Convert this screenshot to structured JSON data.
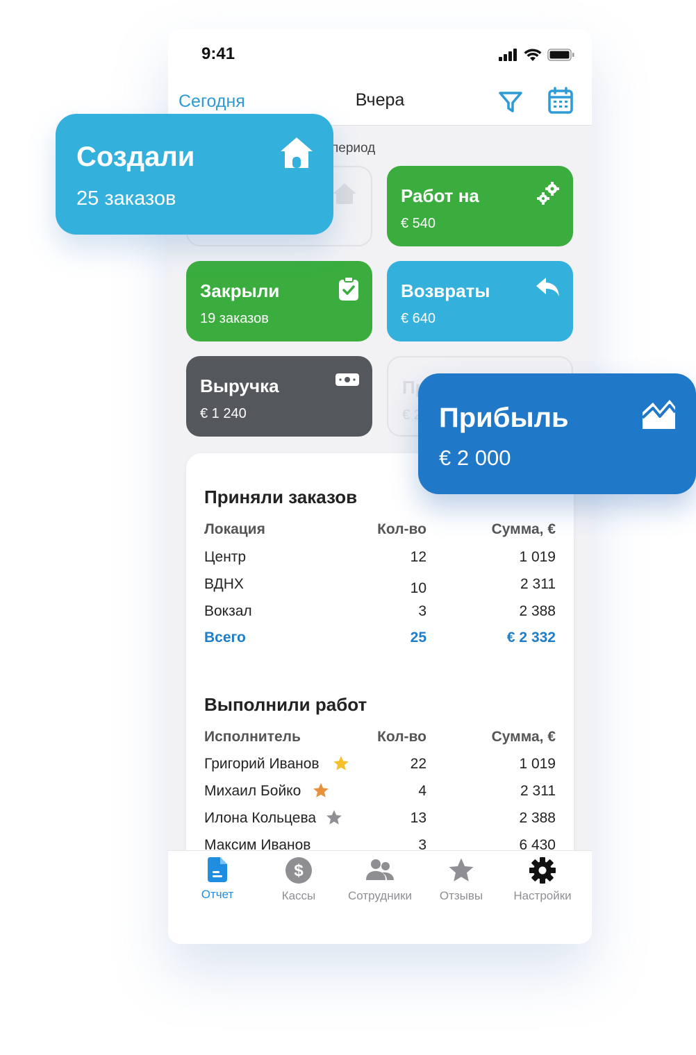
{
  "status_bar": {
    "time": "9:41"
  },
  "nav": {
    "left": "Сегодня",
    "title": "Вчера"
  },
  "period_label": "период",
  "cards": [
    {
      "title": "Работ на",
      "value": "€ 540",
      "icon": "gears-icon",
      "color": "#3aad3e"
    },
    {
      "title": "Закрыли",
      "value": "19 заказов",
      "icon": "clipboard-check-icon",
      "color": "#3aad3e"
    },
    {
      "title": "Возвраты",
      "value": "€ 640",
      "icon": "reply-icon",
      "color": "#33b0dc"
    },
    {
      "title": "Выручка",
      "value": "€ 1 240",
      "icon": "money-icon",
      "color": "#54575c"
    }
  ],
  "ghost_card": {
    "title": "Пр",
    "value": "€ 2"
  },
  "float_created": {
    "title": "Создали",
    "value": "25 заказов",
    "icon": "home-icon"
  },
  "float_profit": {
    "title": "Прибыль",
    "value": "€ 2 000",
    "icon": "chart-area-icon"
  },
  "orders": {
    "title": "Приняли заказов",
    "headers": [
      "Локация",
      "Кол-во",
      "Сумма, €"
    ],
    "rows": [
      [
        "Центр",
        "12",
        "1 019"
      ],
      [
        "ВДНХ",
        "10",
        "2 311"
      ],
      [
        "Вокзал",
        "3",
        "2 388"
      ]
    ],
    "total": [
      "Всего",
      "25",
      "€ 2 332"
    ]
  },
  "works": {
    "title": "Выполнили работ",
    "headers": [
      "Исполнитель",
      "Кол-во",
      "Сумма, €"
    ],
    "rows": [
      [
        "Григорий Иванов",
        "22",
        "1 019"
      ],
      [
        "Михаил Бойко",
        "4",
        "2 311"
      ],
      [
        "Илона Кольцева",
        "13",
        "2 388"
      ],
      [
        "Максим Иванов",
        "3",
        "6 430"
      ]
    ],
    "star_colors": [
      "#f5c02a",
      "#e8913a",
      "#8e8e93"
    ]
  },
  "tabs": [
    {
      "label": "Отчет",
      "icon": "report-icon"
    },
    {
      "label": "Кассы",
      "icon": "dollar-icon"
    },
    {
      "label": "Сотрудники",
      "icon": "people-icon"
    },
    {
      "label": "Отзывы",
      "icon": "star-icon"
    },
    {
      "label": "Настройки",
      "icon": "gear-icon"
    }
  ],
  "colors": {
    "accent": "#2f9bd6",
    "green": "#3aad3e",
    "blue": "#33b0dc",
    "dark": "#54575c",
    "profit": "#1f78c8"
  }
}
